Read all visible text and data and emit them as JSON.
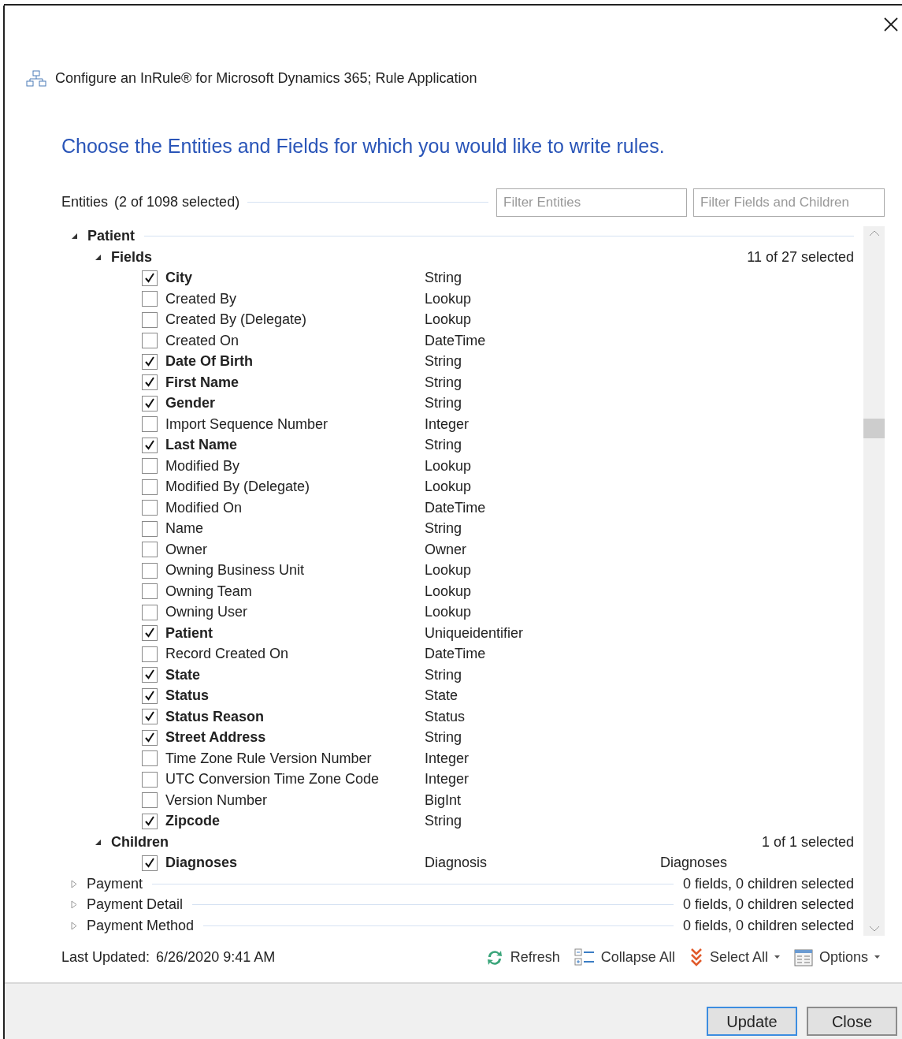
{
  "window": {
    "title": "Configure an InRule® for Microsoft Dynamics 365; Rule Application"
  },
  "heading": "Choose the Entities and Fields for which you would like to write rules.",
  "entities": {
    "label": "Entities",
    "count": "(2 of 1098 selected)"
  },
  "filters": [
    {
      "placeholder": "Filter Entities"
    },
    {
      "placeholder": "Filter Fields and Children"
    }
  ],
  "tree": [
    {
      "name": "Patient",
      "expanded": true,
      "groups": [
        {
          "name": "Fields",
          "expanded": true,
          "summary": "11 of 27 selected",
          "items": [
            {
              "name": "City",
              "type": "String",
              "checked": true
            },
            {
              "name": "Created By",
              "type": "Lookup",
              "checked": false
            },
            {
              "name": "Created By (Delegate)",
              "type": "Lookup",
              "checked": false
            },
            {
              "name": "Created On",
              "type": "DateTime",
              "checked": false
            },
            {
              "name": "Date Of Birth",
              "type": "String",
              "checked": true
            },
            {
              "name": "First Name",
              "type": "String",
              "checked": true
            },
            {
              "name": "Gender",
              "type": "String",
              "checked": true
            },
            {
              "name": "Import Sequence Number",
              "type": "Integer",
              "checked": false
            },
            {
              "name": "Last Name",
              "type": "String",
              "checked": true
            },
            {
              "name": "Modified By",
              "type": "Lookup",
              "checked": false
            },
            {
              "name": "Modified By (Delegate)",
              "type": "Lookup",
              "checked": false
            },
            {
              "name": "Modified On",
              "type": "DateTime",
              "checked": false
            },
            {
              "name": "Name",
              "type": "String",
              "checked": false
            },
            {
              "name": "Owner",
              "type": "Owner",
              "checked": false
            },
            {
              "name": "Owning Business Unit",
              "type": "Lookup",
              "checked": false
            },
            {
              "name": "Owning Team",
              "type": "Lookup",
              "checked": false
            },
            {
              "name": "Owning User",
              "type": "Lookup",
              "checked": false
            },
            {
              "name": "Patient",
              "type": "Uniqueidentifier",
              "checked": true
            },
            {
              "name": "Record Created On",
              "type": "DateTime",
              "checked": false
            },
            {
              "name": "State",
              "type": "String",
              "checked": true
            },
            {
              "name": "Status",
              "type": "State",
              "checked": true
            },
            {
              "name": "Status Reason",
              "type": "Status",
              "checked": true
            },
            {
              "name": "Street Address",
              "type": "String",
              "checked": true
            },
            {
              "name": "Time Zone Rule Version Number",
              "type": "Integer",
              "checked": false
            },
            {
              "name": "UTC Conversion Time Zone Code",
              "type": "Integer",
              "checked": false
            },
            {
              "name": "Version Number",
              "type": "BigInt",
              "checked": false
            },
            {
              "name": "Zipcode",
              "type": "String",
              "checked": true
            }
          ]
        },
        {
          "name": "Children",
          "expanded": true,
          "summary": "1 of 1 selected",
          "items": [
            {
              "name": "Diagnoses",
              "type": "Diagnosis",
              "relation": "Diagnoses",
              "checked": true
            }
          ]
        }
      ]
    },
    {
      "name": "Payment",
      "expanded": false,
      "summary": "0 fields, 0 children selected"
    },
    {
      "name": "Payment Detail",
      "expanded": false,
      "summary": "0 fields, 0 children selected"
    },
    {
      "name": "Payment Method",
      "expanded": false,
      "summary": "0 fields, 0 children selected"
    }
  ],
  "last_updated": {
    "label": "Last Updated:",
    "value": "6/26/2020 9:41 AM"
  },
  "toolbar": [
    {
      "kind": "refresh",
      "label": "Refresh",
      "dropdown": false
    },
    {
      "kind": "collapse",
      "label": "Collapse All",
      "dropdown": false
    },
    {
      "kind": "select",
      "label": "Select All",
      "dropdown": true
    },
    {
      "kind": "options",
      "label": "Options",
      "dropdown": true
    }
  ],
  "buttons": [
    {
      "label": "Update",
      "default": true
    },
    {
      "label": "Close",
      "default": false
    }
  ]
}
